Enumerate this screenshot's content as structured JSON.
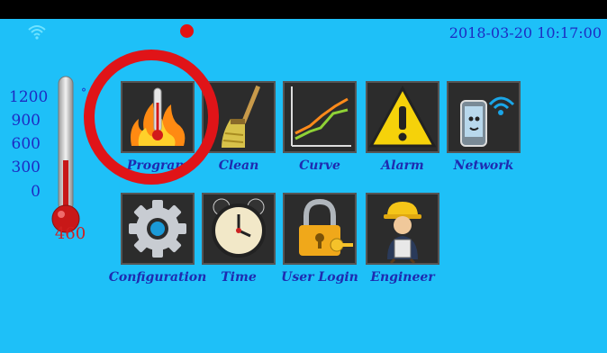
{
  "status_bar": {
    "wifi_icon": "wifi-icon",
    "record_indicator_color": "#e41212",
    "datetime": "2018-03-20 10:17:00"
  },
  "thermometer": {
    "scale": [
      "1200",
      "900",
      "600",
      "300",
      "0"
    ],
    "unit": "°",
    "current_value": "460"
  },
  "menu": {
    "row1": [
      {
        "label": "Program",
        "icon": "fire-thermometer-icon"
      },
      {
        "label": "Clean",
        "icon": "broom-icon"
      },
      {
        "label": "Curve",
        "icon": "line-chart-icon"
      },
      {
        "label": "Alarm",
        "icon": "warning-icon"
      },
      {
        "label": "Network",
        "icon": "phone-wifi-icon"
      }
    ],
    "row2": [
      {
        "label": "Configuration",
        "icon": "gear-icon"
      },
      {
        "label": "Time",
        "icon": "alarm-clock-icon"
      },
      {
        "label": "User Login",
        "icon": "padlock-key-icon"
      },
      {
        "label": "Engineer",
        "icon": "engineer-icon"
      }
    ]
  },
  "highlight": {
    "target": "Program",
    "color": "#e01418"
  },
  "colors": {
    "background": "#1ec0f8",
    "label": "#1e2bb0",
    "scale": "#1d2cc3",
    "temperature": "#d02020"
  }
}
